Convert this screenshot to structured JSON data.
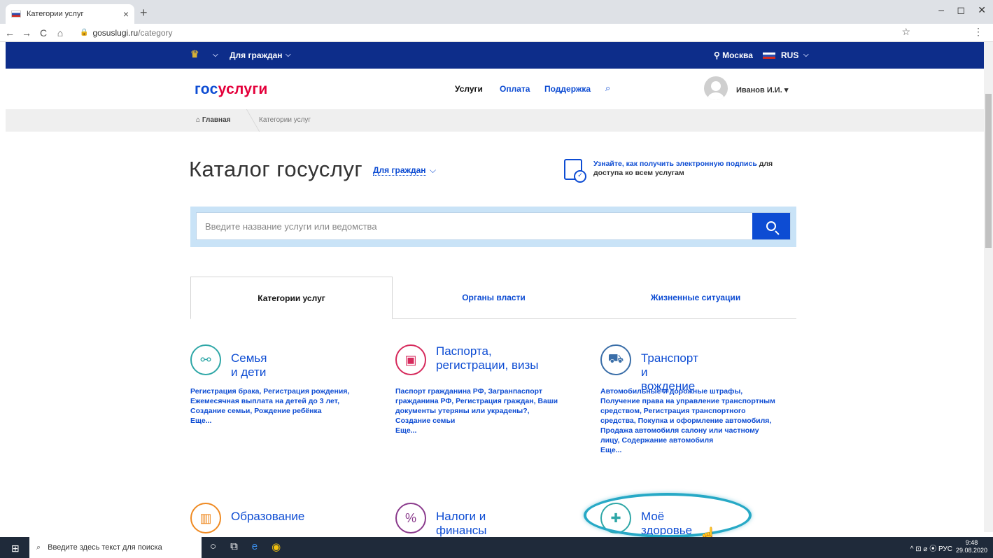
{
  "browser": {
    "tab_title": "Категории услуг",
    "tab_close": "×",
    "new_tab": "+",
    "url_domain": "gosuslugi.ru",
    "url_path": "/category",
    "back": "←",
    "forward": "→",
    "reload": "C",
    "home": "⌂",
    "star": "☆",
    "menu": "⋮",
    "minimize": "–",
    "maximize": "◻",
    "close": "✕"
  },
  "topbar": {
    "audience": "Для граждан",
    "city": "Москва",
    "language": "RUS",
    "arrow": "⌵"
  },
  "nav": {
    "logo_part1": "гос",
    "logo_part2": "услуги",
    "links": [
      "Услуги",
      "Оплата",
      "Поддержка"
    ],
    "search_icon": "⌕",
    "username": "Иванов И.И.",
    "user_arrow": "▾"
  },
  "breadcrumb": {
    "home": "Главная",
    "current": "Категории услуг"
  },
  "catalog": {
    "title": "Каталог госуслуг",
    "filter": "Для граждан",
    "filter_arrow": "⌵",
    "signature_link": "Узнайте, как получить электронную подпись",
    "signature_rest": " для доступа ко всем услугам"
  },
  "search": {
    "placeholder": "Введите название услуги или ведомства"
  },
  "tabs": [
    "Категории услуг",
    "Органы власти",
    "Жизненные ситуации"
  ],
  "categories": [
    {
      "title": "Семья и дети",
      "icon": "stroller-icon",
      "color": "#2fa7a7",
      "desc": "Регистрация брака, Регистрация рождения, Ежемесячная выплата на детей до 3 лет, Создание семьи, Рождение ребёнка",
      "more": "Еще..."
    },
    {
      "title": "Паспорта, регистрации, визы",
      "icon": "passport-icon",
      "color": "#d62a5c",
      "desc": "Паспорт гражданина РФ, Загранпаспорт гражданина РФ, Регистрация граждан, Ваши документы утеряны или украдены?, Создание семьи",
      "more": "Еще..."
    },
    {
      "title": "Транспорт и вождение",
      "icon": "car-icon",
      "color": "#3a6ea8",
      "desc": "Автомобильные и дорожные штрафы, Получение права на управление транспортным средством, Регистрация транспортного средства, Покупка и оформление автомобиля, Продажа автомобиля салону или частному лицу, Содержание автомобиля",
      "more": "Еще..."
    },
    {
      "title": "Образование",
      "icon": "book-icon",
      "color": "#ef8a22"
    },
    {
      "title": "Налоги и финансы",
      "icon": "tax-icon",
      "color": "#8a3a8c"
    },
    {
      "title": "Моё здоровье",
      "icon": "health-cross-icon",
      "color": "#2fa7a7"
    }
  ],
  "taskbar": {
    "search_placeholder": "Введите здесь текст для поиска",
    "tray": "^ ⊡ ⌀ ⦿ РУС",
    "time": "9:48",
    "date": "29.08.2020"
  }
}
